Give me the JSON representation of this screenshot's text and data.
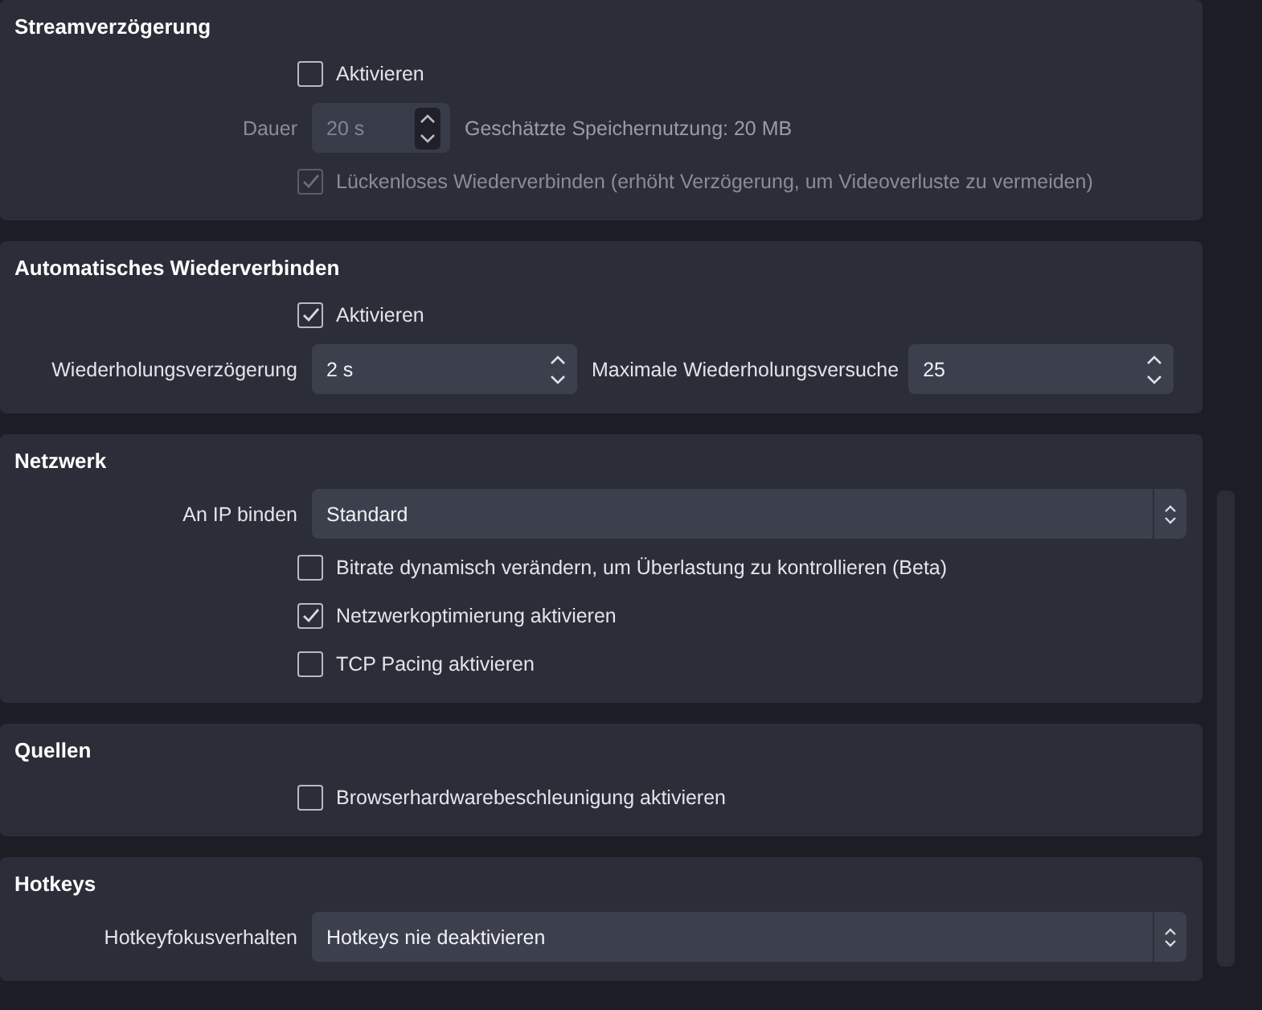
{
  "sections": [
    {
      "title": "Streamverzögerung",
      "rows": [
        {
          "kind": "checkbox",
          "label": "Aktivieren",
          "checked": false,
          "disabled": false
        },
        {
          "kind": "spin",
          "label": "Dauer",
          "value": "20 s",
          "note": "Geschätzte Speichernutzung: 20 MB",
          "disabled": true
        },
        {
          "kind": "checkbox",
          "label": "Lückenloses Wiederverbinden (erhöht Verzögerung, um Videoverluste zu vermeiden)",
          "checked": true,
          "disabled": true
        }
      ]
    },
    {
      "title": "Automatisches Wiederverbinden",
      "rows": [
        {
          "kind": "checkbox",
          "label": "Aktivieren",
          "checked": true,
          "disabled": false
        },
        {
          "kind": "spin_pair",
          "fields": [
            {
              "label": "Wiederholungsverzögerung",
              "value": "2 s"
            },
            {
              "label": "Maximale Wiederholungsversuche",
              "value": "25"
            }
          ]
        }
      ]
    },
    {
      "title": "Netzwerk",
      "rows": [
        {
          "kind": "select",
          "label": "An IP binden",
          "value": "Standard"
        },
        {
          "kind": "checkbox",
          "label": "Bitrate dynamisch verändern, um Überlastung zu kontrollieren (Beta)",
          "checked": false,
          "disabled": false
        },
        {
          "kind": "checkbox",
          "label": "Netzwerkoptimierung aktivieren",
          "checked": true,
          "disabled": false
        },
        {
          "kind": "checkbox",
          "label": "TCP Pacing aktivieren",
          "checked": false,
          "disabled": false
        }
      ]
    },
    {
      "title": "Quellen",
      "rows": [
        {
          "kind": "checkbox",
          "label": "Browserhardwarebeschleunigung aktivieren",
          "checked": false,
          "disabled": false
        }
      ]
    },
    {
      "title": "Hotkeys",
      "rows": [
        {
          "kind": "select",
          "label": "Hotkeyfokusverhalten",
          "value": "Hotkeys nie deaktivieren"
        }
      ]
    }
  ]
}
